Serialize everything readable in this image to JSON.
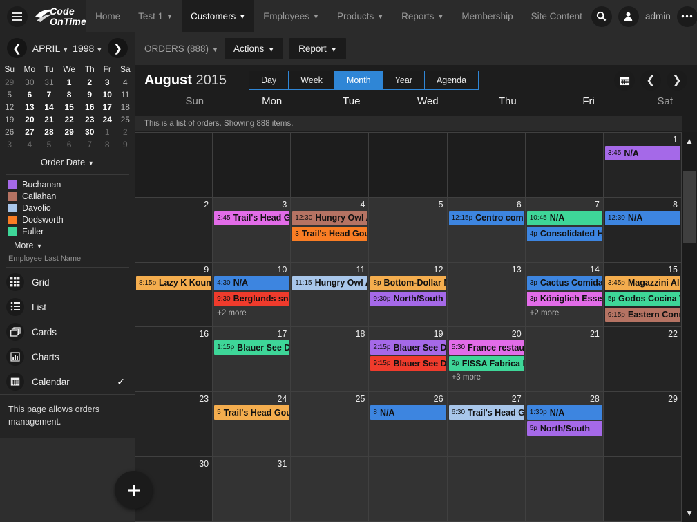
{
  "brand": {
    "name_line1": "Code",
    "name_line2": "OnTime"
  },
  "topnav": {
    "items": [
      {
        "label": "Home",
        "caret": false,
        "active": false
      },
      {
        "label": "Test 1",
        "caret": true,
        "active": false
      },
      {
        "label": "Customers",
        "caret": true,
        "active": true
      },
      {
        "label": "Employees",
        "caret": true,
        "active": false
      },
      {
        "label": "Products",
        "caret": true,
        "active": false
      },
      {
        "label": "Reports",
        "caret": true,
        "active": false
      },
      {
        "label": "Membership",
        "caret": false,
        "active": false
      },
      {
        "label": "Site Content",
        "caret": false,
        "active": false
      }
    ],
    "username": "admin"
  },
  "minicalendar": {
    "month": "APRIL",
    "year": "1998",
    "weekday_headers": [
      "Su",
      "Mo",
      "Tu",
      "We",
      "Th",
      "Fr",
      "Sa"
    ],
    "weeks": [
      [
        {
          "d": "29",
          "k": "out"
        },
        {
          "d": "30",
          "k": "outwk"
        },
        {
          "d": "31",
          "k": "outwk"
        },
        {
          "d": "1",
          "k": "wk"
        },
        {
          "d": "2",
          "k": "wk"
        },
        {
          "d": "3",
          "k": "wk"
        },
        {
          "d": "4",
          "k": "we"
        }
      ],
      [
        {
          "d": "5",
          "k": "we"
        },
        {
          "d": "6",
          "k": "wk"
        },
        {
          "d": "7",
          "k": "wk"
        },
        {
          "d": "8",
          "k": "wk"
        },
        {
          "d": "9",
          "k": "wk"
        },
        {
          "d": "10",
          "k": "wk"
        },
        {
          "d": "11",
          "k": "we"
        }
      ],
      [
        {
          "d": "12",
          "k": "we"
        },
        {
          "d": "13",
          "k": "wk"
        },
        {
          "d": "14",
          "k": "wk"
        },
        {
          "d": "15",
          "k": "wk"
        },
        {
          "d": "16",
          "k": "wk"
        },
        {
          "d": "17",
          "k": "wk"
        },
        {
          "d": "18",
          "k": "we"
        }
      ],
      [
        {
          "d": "19",
          "k": "we"
        },
        {
          "d": "20",
          "k": "wk"
        },
        {
          "d": "21",
          "k": "wk"
        },
        {
          "d": "22",
          "k": "wk"
        },
        {
          "d": "23",
          "k": "wk"
        },
        {
          "d": "24",
          "k": "wk"
        },
        {
          "d": "25",
          "k": "we"
        }
      ],
      [
        {
          "d": "26",
          "k": "we"
        },
        {
          "d": "27",
          "k": "wk"
        },
        {
          "d": "28",
          "k": "wk"
        },
        {
          "d": "29",
          "k": "wk"
        },
        {
          "d": "30",
          "k": "wk"
        },
        {
          "d": "1",
          "k": "out"
        },
        {
          "d": "2",
          "k": "out"
        }
      ],
      [
        {
          "d": "3",
          "k": "out"
        },
        {
          "d": "4",
          "k": "out"
        },
        {
          "d": "5",
          "k": "out"
        },
        {
          "d": "6",
          "k": "out"
        },
        {
          "d": "7",
          "k": "out"
        },
        {
          "d": "8",
          "k": "out"
        },
        {
          "d": "9",
          "k": "out"
        }
      ]
    ],
    "date_field_label": "Order Date"
  },
  "legend": {
    "entries": [
      {
        "label": "Buchanan",
        "color": "#a569e8"
      },
      {
        "label": "Callahan",
        "color": "#b57363"
      },
      {
        "label": "Davolio",
        "color": "#a8c6ea"
      },
      {
        "label": "Dodsworth",
        "color": "#f97d24"
      },
      {
        "label": "Fuller",
        "color": "#3ed698"
      }
    ],
    "more_label": "More",
    "field_label": "Employee Last Name"
  },
  "views": {
    "items": [
      {
        "label": "Grid",
        "icon": "grid-icon",
        "checked": false
      },
      {
        "label": "List",
        "icon": "list-icon",
        "checked": false
      },
      {
        "label": "Cards",
        "icon": "cards-icon",
        "checked": false
      },
      {
        "label": "Charts",
        "icon": "charts-icon",
        "checked": false
      },
      {
        "label": "Calendar",
        "icon": "calendar-icon",
        "checked": true
      }
    ]
  },
  "page_description": "This page allows orders management.",
  "commandbar": {
    "context_label": "ORDERS (888)",
    "actions_label": "Actions",
    "report_label": "Report"
  },
  "calendar": {
    "title_month": "August",
    "title_year": "2015",
    "view_tabs": [
      {
        "label": "Day",
        "active": false
      },
      {
        "label": "Week",
        "active": false
      },
      {
        "label": "Month",
        "active": true
      },
      {
        "label": "Year",
        "active": false
      },
      {
        "label": "Agenda",
        "active": false
      }
    ],
    "info_text": "This is a list of orders. Showing 888 items.",
    "day_headers": [
      {
        "label": "Sun",
        "weekend": true
      },
      {
        "label": "Mon",
        "weekend": false
      },
      {
        "label": "Tue",
        "weekend": false
      },
      {
        "label": "Wed",
        "weekend": false
      },
      {
        "label": "Thu",
        "weekend": false
      },
      {
        "label": "Fri",
        "weekend": false
      },
      {
        "label": "Sat",
        "weekend": true
      }
    ],
    "weeks": [
      [
        {
          "blank": true
        },
        {
          "blank": true
        },
        {
          "blank": true
        },
        {
          "blank": true
        },
        {
          "blank": true
        },
        {
          "blank": true
        },
        {
          "day": "1",
          "weekend": true,
          "events": [
            {
              "time": "3:45",
              "title": "N/A",
              "color": "#a569e8"
            }
          ]
        }
      ],
      [
        {
          "day": "2",
          "weekend": true,
          "events": []
        },
        {
          "day": "3",
          "events": [
            {
              "time": "2:45",
              "title": "Trail's Head Go",
              "color": "#e26ce8"
            }
          ]
        },
        {
          "day": "4",
          "events": [
            {
              "time": "12:30",
              "title": "Hungry Owl A",
              "color": "#b57363"
            },
            {
              "time": "3",
              "title": "Trail's Head Gour",
              "color": "#f97d24"
            }
          ]
        },
        {
          "day": "5",
          "events": []
        },
        {
          "day": "6",
          "events": [
            {
              "time": "12:15p",
              "title": "Centro come",
              "color": "#3d85e0"
            }
          ]
        },
        {
          "day": "7",
          "events": [
            {
              "time": "10:45",
              "title": "N/A",
              "color": "#3ed698"
            },
            {
              "time": "4p",
              "title": "Consolidated Ho",
              "color": "#3d85e0"
            }
          ]
        },
        {
          "day": "8",
          "weekend": true,
          "events": [
            {
              "time": "12:30",
              "title": "N/A",
              "color": "#3d85e0"
            }
          ]
        }
      ],
      [
        {
          "day": "9",
          "weekend": true,
          "events": [
            {
              "time": "8:15p",
              "title": "Lazy K Kountr",
              "color": "#f4ad4e"
            }
          ]
        },
        {
          "day": "10",
          "events": [
            {
              "time": "4:30",
              "title": "N/A",
              "color": "#3d85e0"
            },
            {
              "time": "9:30",
              "title": "Berglunds snab",
              "color": "#ef3b2c"
            }
          ],
          "more": "+2 more"
        },
        {
          "day": "11",
          "events": [
            {
              "time": "11:15",
              "title": "Hungry Owl A",
              "color": "#a8c6ea"
            }
          ]
        },
        {
          "day": "12",
          "events": [
            {
              "time": "8p",
              "title": "Bottom-Dollar N",
              "color": "#f4ad4e"
            },
            {
              "time": "9:30p",
              "title": "North/South",
              "color": "#a569e8"
            }
          ]
        },
        {
          "day": "13",
          "events": []
        },
        {
          "day": "14",
          "events": [
            {
              "time": "3p",
              "title": "Cactus Comidas",
              "color": "#3d85e0"
            },
            {
              "time": "3p",
              "title": "Königlich Essen",
              "color": "#e26ce8"
            }
          ],
          "more": "+2 more"
        },
        {
          "day": "15",
          "weekend": true,
          "events": [
            {
              "time": "3:45p",
              "title": "Magazzini Ali",
              "color": "#f4ad4e"
            },
            {
              "time": "5p",
              "title": "Godos Cocina Tí",
              "color": "#3ed698"
            },
            {
              "time": "9:15p",
              "title": "Eastern Conne",
              "color": "#b57363"
            }
          ]
        }
      ],
      [
        {
          "day": "16",
          "weekend": true,
          "events": []
        },
        {
          "day": "17",
          "events": [
            {
              "time": "1:15p",
              "title": "Blauer See De",
              "color": "#3ed698"
            }
          ]
        },
        {
          "day": "18",
          "events": []
        },
        {
          "day": "19",
          "events": [
            {
              "time": "2:15p",
              "title": "Blauer See De",
              "color": "#a569e8"
            },
            {
              "time": "9:15p",
              "title": "Blauer See De",
              "color": "#ef3b2c"
            }
          ]
        },
        {
          "day": "20",
          "events": [
            {
              "time": "5:30",
              "title": "France restaura",
              "color": "#e26ce8"
            },
            {
              "time": "2p",
              "title": "FISSA Fabrica In",
              "color": "#3ed698"
            }
          ],
          "more": "+3 more"
        },
        {
          "day": "21",
          "events": []
        },
        {
          "day": "22",
          "weekend": true,
          "events": []
        }
      ],
      [
        {
          "day": "23",
          "weekend": true,
          "events": []
        },
        {
          "day": "24",
          "events": [
            {
              "time": "5",
              "title": "Trail's Head Gour",
              "color": "#f4ad4e"
            }
          ]
        },
        {
          "day": "25",
          "events": []
        },
        {
          "day": "26",
          "events": [
            {
              "time": "8",
              "title": "N/A",
              "color": "#3d85e0"
            }
          ]
        },
        {
          "day": "27",
          "events": [
            {
              "time": "6:30",
              "title": "Trail's Head Go",
              "color": "#a8c6ea"
            }
          ]
        },
        {
          "day": "28",
          "events": [
            {
              "time": "1:30p",
              "title": "N/A",
              "color": "#3d85e0"
            },
            {
              "time": "5p",
              "title": "North/South",
              "color": "#a569e8"
            }
          ]
        },
        {
          "day": "29",
          "weekend": true,
          "events": []
        }
      ],
      [
        {
          "day": "30",
          "weekend": true,
          "events": []
        },
        {
          "day": "31",
          "events": []
        },
        {
          "day": "",
          "events": []
        },
        {
          "day": "",
          "events": []
        },
        {
          "day": "",
          "events": []
        },
        {
          "day": "",
          "events": []
        },
        {
          "day": "",
          "weekend": true,
          "events": []
        }
      ]
    ]
  },
  "fab_label": "+"
}
